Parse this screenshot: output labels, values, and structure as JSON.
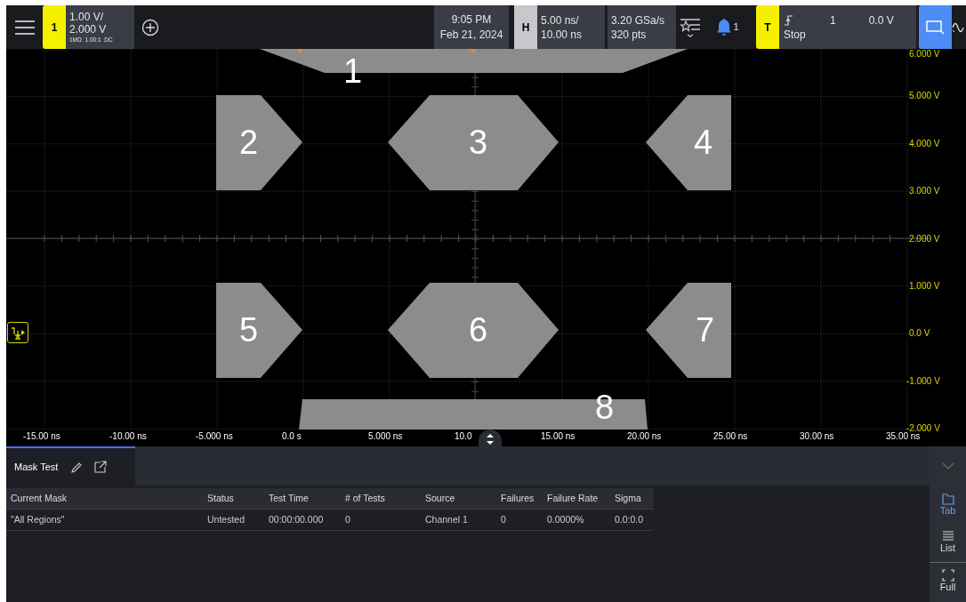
{
  "top_bar": {
    "channel": {
      "number": "1",
      "scale": "1.00 V/",
      "offset": "2.000 V",
      "settings": "1MΩ  1.00:1  DC"
    },
    "clock": {
      "time": "9:05 PM",
      "date": "Feb 21, 2024"
    },
    "horizontal": {
      "badge": "H",
      "scale": "5.00 ns/",
      "position": "10.00 ns"
    },
    "acquisition": {
      "rate": "3.20 GSa/s",
      "points": "320 pts"
    },
    "notifications": {
      "count": "1"
    },
    "trigger": {
      "badge": "T",
      "source": "1",
      "level": "0.0 V",
      "state": "Stop"
    }
  },
  "plot": {
    "y_labels": [
      "6.000 V",
      "5.000 V",
      "4.000 V",
      "3.000 V",
      "2.000 V",
      "1.000 V",
      "0.0 V",
      "-1.000 V",
      "-2.000 V"
    ],
    "x_labels": [
      "-15.00 ns",
      "-10.00 ns",
      "-5.000 ns",
      "0.0 s",
      "5.000 ns",
      "10.0",
      "15.00 ns",
      "20.00 ns",
      "25.00 ns",
      "30.00 ns",
      "35.00 ns"
    ],
    "mask_regions": [
      {
        "label": "1",
        "kind": "trapezoid-top"
      },
      {
        "label": "2",
        "kind": "arrow-right"
      },
      {
        "label": "3",
        "kind": "hexagon"
      },
      {
        "label": "4",
        "kind": "arrow-left"
      },
      {
        "label": "5",
        "kind": "arrow-right"
      },
      {
        "label": "6",
        "kind": "hexagon"
      },
      {
        "label": "7",
        "kind": "arrow-left"
      },
      {
        "label": "8",
        "kind": "trapezoid-bottom"
      }
    ]
  },
  "panel": {
    "tabs": [
      {
        "label": "Mask Test",
        "selected": true
      }
    ],
    "table": {
      "columns": [
        "Current Mask",
        "Status",
        "Test Time",
        "# of Tests",
        "Source",
        "Failures",
        "Failure Rate",
        "Sigma"
      ],
      "rows": [
        [
          "\"All Regions\"",
          "Untested",
          "00:00:00.000",
          "0",
          "Channel 1",
          "0",
          "0.0000%",
          "0.0:0.0"
        ]
      ]
    },
    "view_buttons": [
      {
        "label": "Tab",
        "kind": "tab",
        "selected": true
      },
      {
        "label": "List",
        "kind": "list",
        "selected": false
      },
      {
        "label": "Full",
        "kind": "full",
        "selected": false
      }
    ]
  }
}
